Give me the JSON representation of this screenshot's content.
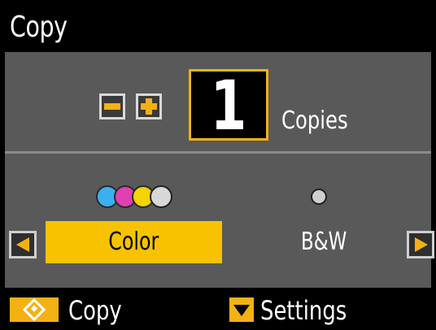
{
  "header": {
    "title": "Copy"
  },
  "copies": {
    "count": "1",
    "label": "Copies",
    "minus_icon": "minus-icon",
    "plus_icon": "plus-icon"
  },
  "color_mode": {
    "options": [
      {
        "label": "Color",
        "selected": true,
        "indicator": "cmyk-ink-dots-icon"
      },
      {
        "label": "B&W",
        "selected": false,
        "indicator": "black-ink-dot-icon"
      }
    ],
    "left_arrow_icon": "left-arrow-icon",
    "right_arrow_icon": "right-arrow-icon"
  },
  "footer": {
    "start_label": "Copy",
    "start_icon": "start-diamond-icon",
    "settings_label": "Settings",
    "settings_icon": "down-arrow-icon"
  },
  "colors": {
    "accent": "#f3b114",
    "selected_bg": "#f7c300",
    "panel": "#595959",
    "cyan": "#3ab0f0",
    "magenta": "#e040b0",
    "yellow": "#f2d400"
  }
}
